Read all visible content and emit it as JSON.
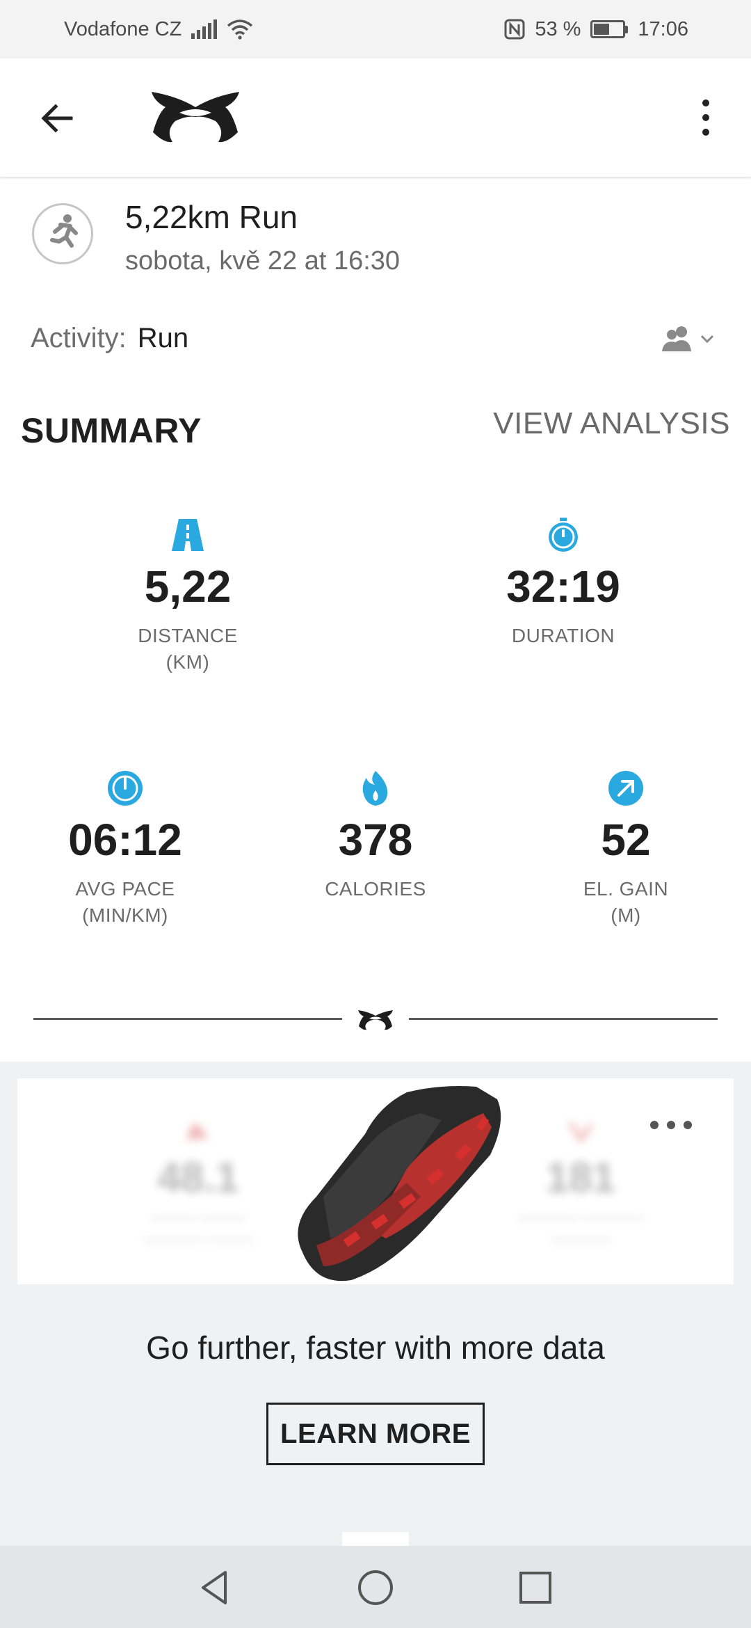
{
  "status_bar": {
    "carrier": "Vodafone CZ",
    "battery": "53 %",
    "time": "17:06",
    "icons": [
      "signal-icon",
      "wifi-icon",
      "nfc-icon",
      "battery-icon"
    ]
  },
  "app_bar": {
    "logo": "under-armour-logo",
    "icons": [
      "back-arrow-icon",
      "more-vert-icon"
    ]
  },
  "workout": {
    "title": "5,22km Run",
    "subtitle": "sobota, kvě 22 at 16:30",
    "icon": "runner-icon"
  },
  "activity": {
    "label": "Activity:",
    "value": "Run",
    "privacy_icon": "friends-privacy-icon"
  },
  "summary": {
    "title": "SUMMARY",
    "link": "VIEW ANALYSIS",
    "stats": [
      {
        "icon": "road-icon",
        "value": "5,22",
        "label": "DISTANCE\n(KM)"
      },
      {
        "icon": "stopwatch-icon",
        "value": "32:19",
        "label": "DURATION"
      },
      {
        "icon": "speedometer-icon",
        "value": "06:12",
        "label": "AVG PACE\n(MIN/KM)"
      },
      {
        "icon": "flame-icon",
        "value": "378",
        "label": "CALORIES"
      },
      {
        "icon": "arrow-up-right-icon",
        "value": "52",
        "label": "EL. GAIN\n(M)"
      }
    ]
  },
  "promo": {
    "blurred_left_value": "48.1",
    "blurred_right_value": "181",
    "text": "Go further, faster with more data",
    "button": "LEARN MORE"
  },
  "colors": {
    "accent": "#2aa8e0",
    "text": "#1f1f1f",
    "muted": "#6b6b6b",
    "promo_bg": "#f0f1f3",
    "shoe_red": "#d5302e"
  }
}
